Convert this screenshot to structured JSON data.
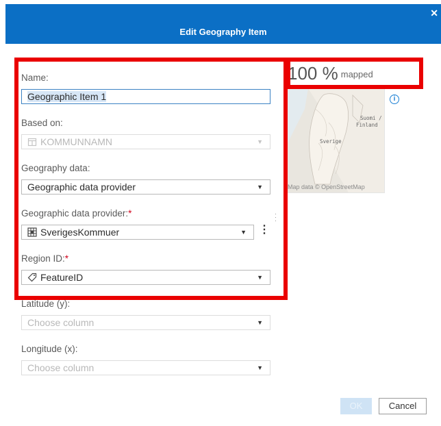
{
  "dialog": {
    "title": "Edit Geography Item",
    "close_icon": "close-icon"
  },
  "form": {
    "name_label": "Name:",
    "name_value": "Geographic Item 1",
    "based_on_label": "Based on:",
    "based_on_value": "KOMMUNNAMN",
    "geography_data_label": "Geography data:",
    "geography_data_value": "Geographic data provider",
    "provider_label": "Geographic data provider:",
    "provider_required": "*",
    "provider_value": "SverigesKommuer",
    "region_id_label": "Region ID:",
    "region_id_required": "*",
    "region_id_value": "FeatureID",
    "latitude_label": "Latitude (y):",
    "latitude_placeholder": "Choose column",
    "longitude_label": "Longitude (x):",
    "longitude_placeholder": "Choose column",
    "dropdown_arrow": "▼"
  },
  "preview": {
    "percent": "100 %",
    "mapped_label": "mapped",
    "map_credit": "Map data © OpenStreetMap",
    "map_label_finland_1": "Suomi /",
    "map_label_finland_2": "Finland",
    "map_label_sverige": "Sverige",
    "mapped_fraction": 1.0
  },
  "footer": {
    "ok_label": "OK",
    "cancel_label": "Cancel"
  },
  "colors": {
    "titlebar": "#0b6fc5",
    "highlight": "#ea0000",
    "required": "#d0021b"
  }
}
